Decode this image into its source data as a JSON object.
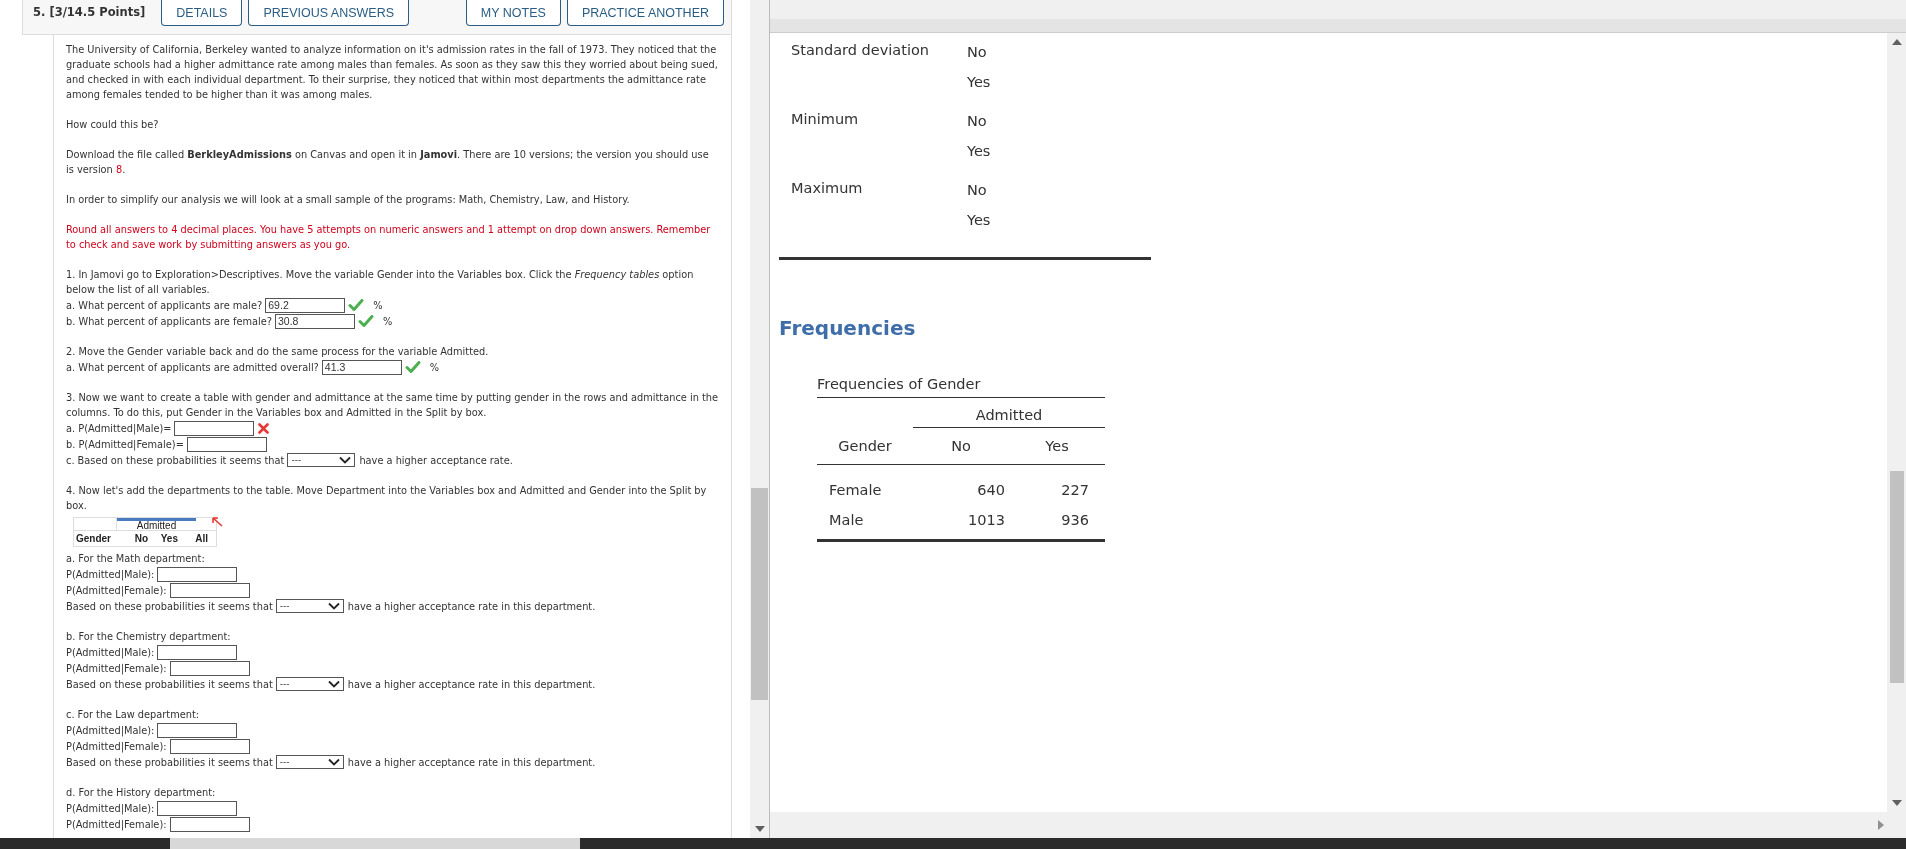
{
  "question": {
    "number": "5.",
    "points": "[3/14.5 Points]",
    "buttons_left": [
      {
        "label": "DETAILS"
      },
      {
        "label": "PREVIOUS ANSWERS"
      }
    ],
    "buttons_right": [
      {
        "label": "MY NOTES"
      },
      {
        "label": "PRACTICE ANOTHER"
      }
    ]
  },
  "sections": [
    {
      "lines": [
        {
          "kind": "para",
          "text": "The University of California, Berkeley wanted to analyze information on it's admission rates in the fall of 1973. They noticed that the graduate schools had a higher admittance rate among males than females. As soon as they saw this they worried about being sued, and checked in with each individual department. To their surprise, they noticed that within most departments the admittance rate among females tended to be higher than it was among males."
        }
      ]
    },
    {
      "lines": [
        {
          "kind": "para",
          "text": "How could this be?"
        }
      ]
    },
    {
      "lines": [
        {
          "kind": "segments",
          "parts": [
            {
              "text": "Download the file called **BerkleyAdmissions** on Canvas and open it in **Jamovi**. There are 10 versions; the version you should use is version ",
              "red": false
            },
            {
              "text": "8",
              "red": true
            },
            {
              "text": ".",
              "red": false
            }
          ]
        }
      ]
    },
    {
      "lines": [
        {
          "kind": "para",
          "text": "In order to simplify our analysis we will look at a small sample of the programs: Math, Chemistry, Law, and History."
        }
      ]
    },
    {
      "lines": [
        {
          "kind": "notice",
          "text": "Round all answers to 4 decimal places. You have 5 attempts on numeric answers and 1 attempt on drop down answers. Remember to check and save work by submitting answers as you go."
        }
      ]
    },
    {
      "lines": [
        {
          "kind": "para",
          "text": "1. In Jamovi go to Exploration>Descriptives. Move the variable Gender into the Variables box. Click the *Frequency tables* option below the list of all variables."
        },
        {
          "kind": "input",
          "label": "a. What percent of applicants are male?",
          "value": "69.2",
          "correct": true,
          "wrong": false,
          "unit": "%"
        },
        {
          "kind": "input",
          "label": "b. What percent of applicants are female?",
          "value": "30.8",
          "correct": true,
          "wrong": false,
          "unit": "%"
        }
      ]
    },
    {
      "lines": [
        {
          "kind": "para",
          "text": "2. Move the Gender variable back and do the same process for the variable Admitted."
        },
        {
          "kind": "input",
          "label": "a. What percent of applicants are admitted overall?",
          "value": "41.3",
          "correct": true,
          "wrong": false,
          "unit": "%"
        }
      ]
    },
    {
      "lines": [
        {
          "kind": "para",
          "text": "3. Now we want to create a table with gender and admittance at the same time by putting gender in the rows and admittance in the columns. To do this, put Gender in the Variables box and Admitted in the Split by box."
        },
        {
          "kind": "input",
          "label": "a. P(Admitted|Male)=",
          "correct": false,
          "wrong": true
        },
        {
          "kind": "input",
          "label": "b. P(Admitted|Female)=",
          "correct": false,
          "wrong": false
        },
        {
          "kind": "select",
          "before": "c. Based on these probabilities it seems that",
          "value": "---",
          "after": "have a higher acceptance rate."
        }
      ]
    },
    {
      "lines": [
        {
          "kind": "para",
          "text": "4. Now let's add the departments to the table. Move Department into the Variables box and Admitted and Gender into the Split by box."
        },
        {
          "kind": "table_image",
          "group_header": "Admitted",
          "columns": [
            "Gender",
            "No",
            "Yes",
            "All"
          ]
        },
        {
          "kind": "para",
          "text": "a. For the Math department:"
        },
        {
          "kind": "input",
          "label": "P(Admitted|Male):",
          "correct": false,
          "wrong": false
        },
        {
          "kind": "input",
          "label": "P(Admitted|Female):",
          "correct": false,
          "wrong": false
        },
        {
          "kind": "select",
          "before": "Based on these probabilities it seems that",
          "value": "---",
          "after": "have a higher acceptance rate in this department."
        }
      ]
    },
    {
      "lines": [
        {
          "kind": "para",
          "text": "b. For the Chemistry department:"
        },
        {
          "kind": "input",
          "label": "P(Admitted|Male):",
          "correct": false,
          "wrong": false
        },
        {
          "kind": "input",
          "label": "P(Admitted|Female):",
          "correct": false,
          "wrong": false
        },
        {
          "kind": "select",
          "before": "Based on these probabilities it seems that",
          "value": "---",
          "after": "have a higher acceptance rate in this department."
        }
      ]
    },
    {
      "lines": [
        {
          "kind": "para",
          "text": "c. For the Law department:"
        },
        {
          "kind": "input",
          "label": "P(Admitted|Male):",
          "correct": false,
          "wrong": false
        },
        {
          "kind": "input",
          "label": "P(Admitted|Female):",
          "correct": false,
          "wrong": false
        },
        {
          "kind": "select",
          "before": "Based on these probabilities it seems that",
          "value": "---",
          "after": "have a higher acceptance rate in this department."
        }
      ]
    },
    {
      "lines": [
        {
          "kind": "para",
          "text": "d. For the History department:"
        },
        {
          "kind": "input",
          "label": "P(Admitted|Male):",
          "correct": false,
          "wrong": false
        },
        {
          "kind": "input",
          "label": "P(Admitted|Female):",
          "correct": false,
          "wrong": false
        }
      ]
    }
  ],
  "results": {
    "descriptives": [
      {
        "label": "Standard deviation",
        "groups": [
          "No",
          "Yes"
        ]
      },
      {
        "label": "Minimum",
        "groups": [
          "No",
          "Yes"
        ]
      },
      {
        "label": "Maximum",
        "groups": [
          "No",
          "Yes"
        ]
      }
    ],
    "frequencies": {
      "heading": "Frequencies",
      "table_title": "Frequencies of Gender",
      "group_header": "Admitted",
      "columns": [
        "Gender",
        "No",
        "Yes"
      ],
      "rows": [
        [
          "Female",
          "640",
          "227"
        ],
        [
          "Male",
          "1013",
          "936"
        ]
      ]
    }
  }
}
